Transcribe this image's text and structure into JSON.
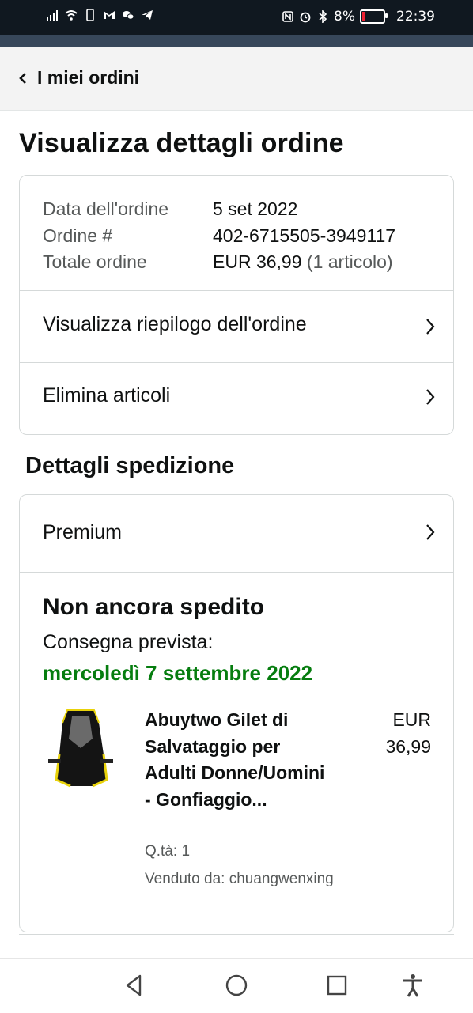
{
  "status_bar": {
    "battery_text": "8%",
    "time": "22:39"
  },
  "nav": {
    "back_label": "I miei ordini"
  },
  "page_title": "Visualizza dettagli ordine",
  "order_info": {
    "date_label": "Data dell'ordine",
    "date_value": "5 set 2022",
    "order_label": "Ordine #",
    "order_value": "402-6715505-3949117",
    "total_label": "Totale ordine",
    "total_value": "EUR 36,99",
    "total_items": "(1 articolo)"
  },
  "order_links": {
    "summary": "Visualizza riepilogo dell'ordine",
    "delete_items": "Elimina articoli"
  },
  "shipping": {
    "section_title": "Dettagli spedizione",
    "premium_label": "Premium",
    "status_title": "Non ancora spedito",
    "delivery_label": "Consegna prevista:",
    "delivery_date": "mercoledì 7 settembre 2022"
  },
  "product": {
    "title": "Abuytwo Gilet di Salvataggio per Adulti Donne/Uomini - Gonfiaggio...",
    "price_currency": "EUR",
    "price_value": "36,99",
    "qty": "Q.tà: 1",
    "seller": "Venduto da: chuangwenxing"
  },
  "colors": {
    "status_bar_bg": "#101820",
    "header_band": "#37475a",
    "delivery_green": "#067d0f",
    "battery_low": "#e22233"
  }
}
